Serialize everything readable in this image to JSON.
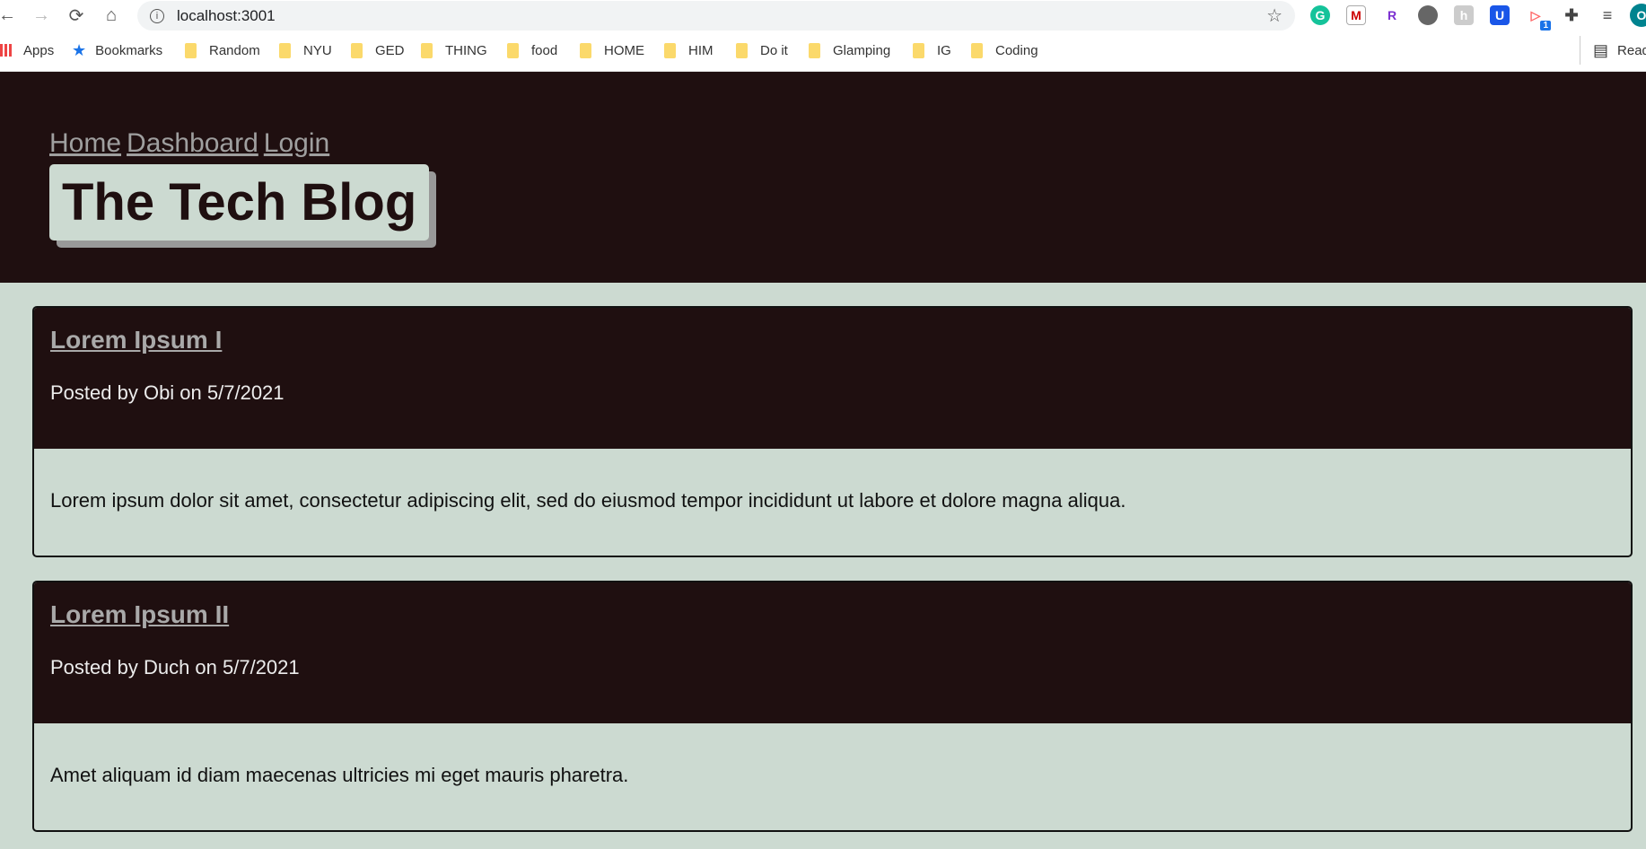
{
  "browser": {
    "url": "localhost:3001",
    "bookmarks": [
      "Apps",
      "Bookmarks",
      "Random",
      "NYU",
      "GED",
      "THING",
      "food",
      "HOME",
      "HIM",
      "Do it",
      "Glamping",
      "IG",
      "Coding"
    ],
    "reading_list": "Read",
    "extension_badge": "1",
    "profile_initial": "O"
  },
  "header": {
    "nav": [
      "Home",
      "Dashboard",
      "Login"
    ],
    "title": "The Tech Blog"
  },
  "posts": [
    {
      "title": "Lorem Ipsum I",
      "meta": "Posted by Obi on 5/7/2021",
      "body": "Lorem ipsum dolor sit amet, consectetur adipiscing elit, sed do eiusmod tempor incididunt ut labore et dolore magna aliqua."
    },
    {
      "title": "Lorem Ipsum II",
      "meta": "Posted by Duch on 5/7/2021",
      "body": "Amet aliquam id diam maecenas ultricies mi eget mauris pharetra."
    }
  ],
  "colors": {
    "dark": "#1f0f10",
    "light": "#ccdad1",
    "link": "#9f9f9f"
  }
}
